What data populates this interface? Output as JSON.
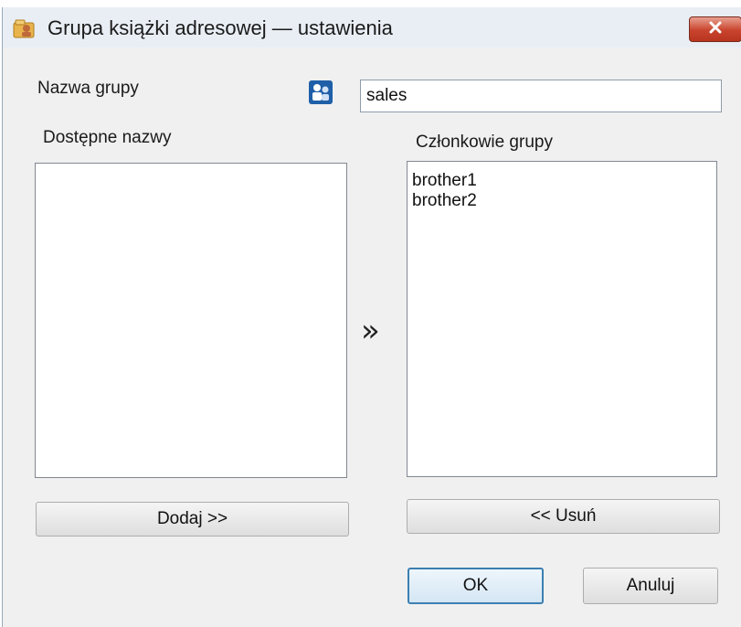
{
  "window": {
    "title": "Grupa książki adresowej — ustawienia"
  },
  "icons": {
    "title": "address-book-icon",
    "close": "close-icon",
    "group": "group-icon",
    "move": "double-right-arrow-icon"
  },
  "form": {
    "group_name_label": "Nazwa grupy",
    "group_name_value": "sales",
    "available_label": "Dostępne nazwy",
    "members_label": "Członkowie grupy",
    "available_items": [],
    "member_items": [
      "brother1",
      "brother2"
    ],
    "move_arrow": "»"
  },
  "buttons": {
    "add": "Dodaj >>",
    "remove": "<< Usuń",
    "ok": "OK",
    "cancel": "Anuluj"
  },
  "colors": {
    "close_button": "#c9432d",
    "default_button_border": "#3c7fb1",
    "group_icon": "#1f5fa8"
  }
}
